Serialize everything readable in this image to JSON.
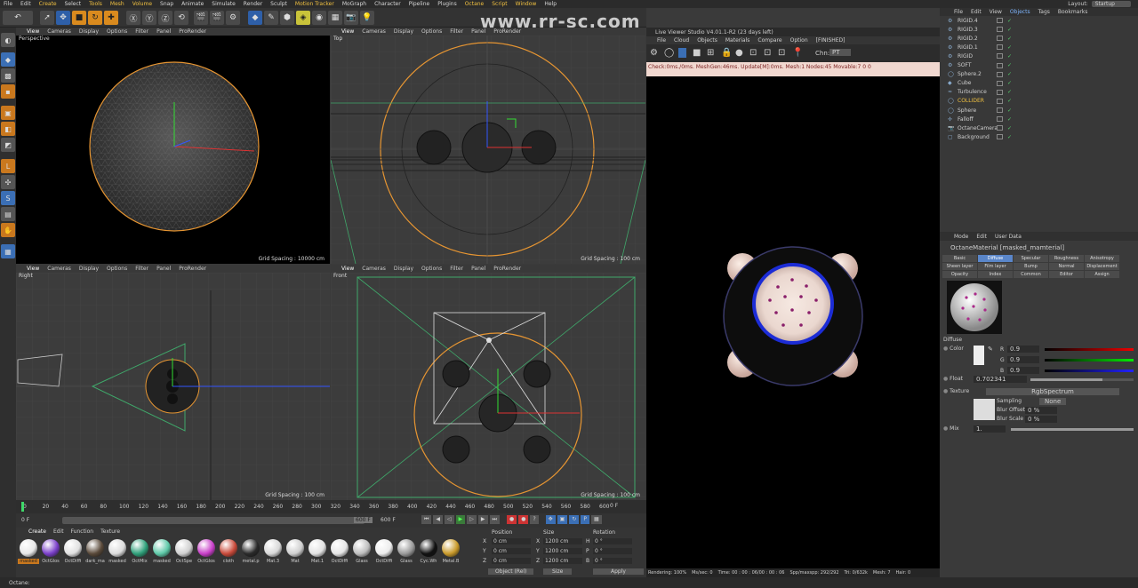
{
  "menubar": {
    "items": [
      "File",
      "Edit",
      "Create",
      "Select",
      "Tools",
      "Mesh",
      "Volume",
      "Snap",
      "Animate",
      "Simulate",
      "Render",
      "Sculpt",
      "Motion Tracker",
      "MoGraph",
      "Character",
      "Pipeline",
      "Plugins",
      "Octane",
      "Script",
      "Window",
      "Help"
    ],
    "layout_label": "Layout:",
    "layout_value": "Startup"
  },
  "watermark": "www.rr-sc.com",
  "viewport_menu": [
    "View",
    "Cameras",
    "Display",
    "Options",
    "Filter",
    "Panel",
    "ProRender"
  ],
  "viewports": [
    {
      "label": "Perspective",
      "grid": "Grid Spacing : 10000 cm"
    },
    {
      "label": "Top",
      "grid": "Grid Spacing : 100 cm"
    },
    {
      "label": "Right",
      "grid": "Grid Spacing : 100 cm"
    },
    {
      "label": "Front",
      "grid": "Grid Spacing : 100 cm"
    }
  ],
  "timeline": {
    "ticks": [
      "0",
      "20",
      "40",
      "60",
      "80",
      "100",
      "120",
      "140",
      "160",
      "180",
      "200",
      "220",
      "240",
      "260",
      "280",
      "300",
      "320",
      "340",
      "360",
      "380",
      "400",
      "420",
      "440",
      "460",
      "480",
      "500",
      "520",
      "540",
      "560",
      "580",
      "600"
    ],
    "current_frame": "0 F",
    "start": "0 F",
    "end": "600 F",
    "end2": "600 F",
    "right_frame": "0 F"
  },
  "material_tabs": [
    "Create",
    "Edit",
    "Function",
    "Texture"
  ],
  "materials": [
    {
      "name": "masked",
      "color": "#e8e8e8"
    },
    {
      "name": "OctGlos",
      "color": "#7a3fc9"
    },
    {
      "name": "OctDiffi",
      "color": "#e0e0e0"
    },
    {
      "name": "dark_ma",
      "color": "#5a4a3a"
    },
    {
      "name": "masked",
      "color": "#dcdcdc"
    },
    {
      "name": "OctMix",
      "color": "#2fa07a"
    },
    {
      "name": "masked",
      "color": "#5ec9a8"
    },
    {
      "name": "OctSpe",
      "color": "#d0d0d0"
    },
    {
      "name": "OctGlos",
      "color": "#c93fc9"
    },
    {
      "name": "cloth",
      "color": "#c94a3a"
    },
    {
      "name": "metal.p",
      "color": "#2a2a2a"
    },
    {
      "name": "Mat.3",
      "color": "#d8d8d8"
    },
    {
      "name": "Mat",
      "color": "#cfcfcf"
    },
    {
      "name": "Mat.1",
      "color": "#e2e2e2"
    },
    {
      "name": "OctDiffi",
      "color": "#e6e6e6"
    },
    {
      "name": "Glass",
      "color": "#bdbdbd"
    },
    {
      "name": "OctDiffi",
      "color": "#ececec"
    },
    {
      "name": "Glass",
      "color": "#9a9a9a"
    },
    {
      "name": "Cyc.Wh",
      "color": "#111111"
    },
    {
      "name": "Metal.B",
      "color": "#c99a2a"
    }
  ],
  "coords": {
    "headers": [
      "Position",
      "Size",
      "Rotation"
    ],
    "rows": [
      {
        "axis": "X",
        "pos": "0 cm",
        "size": "1200 cm",
        "rot_label": "H",
        "rot": "0 °"
      },
      {
        "axis": "Y",
        "pos": "0 cm",
        "size": "1200 cm",
        "rot_label": "P",
        "rot": "0 °"
      },
      {
        "axis": "Z",
        "pos": "0 cm",
        "size": "1200 cm",
        "rot_label": "B",
        "rot": "0 °"
      }
    ],
    "mode": "Object (Rel)",
    "size_mode": "Size",
    "apply": "Apply"
  },
  "status": "Octane:",
  "live": {
    "title": "Live Viewer Studio V4.01.1-R2 (23 days left)",
    "menu": [
      "File",
      "Cloud",
      "Objects",
      "Materials",
      "Compare",
      "Option",
      "[FINISHED]"
    ],
    "chn_label": "Chn:",
    "chn_value": "PT",
    "check": "Check:0ms./0ms. MeshGen:46ms. Update[M]:0ms. Mesh:1 Nodes:45 Movable:7  0 0",
    "bottom": [
      "Rendering: 100%",
      "Ms/sec: 0",
      "Time: 00 : 00 : 06/00 : 00 : 06",
      "Spp/maxspp: 292/292",
      "Tri: 0/632k",
      "Mesh: 7",
      "Hair: 0"
    ]
  },
  "objects": {
    "menu": [
      "File",
      "Edit",
      "View",
      "Objects",
      "Tags",
      "Bookmarks"
    ],
    "items": [
      "RIGID.4",
      "RIGID.3",
      "RIGID.2",
      "RIGID.1",
      "RIGID",
      "SOFT",
      "Sphere.2",
      "Cube",
      "Turbulence",
      "COLLIDER",
      "Sphere",
      "Falloff",
      "OctaneCamera",
      "Background"
    ]
  },
  "attributes": {
    "menu": [
      "Mode",
      "Edit",
      "User Data"
    ],
    "title": "OctaneMaterial [masked_mamterial]",
    "tabs": [
      "Basic",
      "Diffuse",
      "Specular",
      "Roughness",
      "Anisotropy",
      "Sheen layer",
      "Film layer",
      "Bump",
      "Normal",
      "Displacement",
      "Opacity",
      "Index",
      "Common",
      "Editor",
      "Assign"
    ],
    "active_tab": "Diffuse",
    "section": "Diffuse",
    "color_label": "Color",
    "r_label": "R",
    "r": "0.9",
    "g_label": "G",
    "g": "0.9",
    "b_label": "B",
    "b": "0.9",
    "float_label": "Float",
    "float": "0.702341",
    "texture_label": "Texture",
    "texture_value": "RgbSpectrum",
    "sampling_label": "Sampling",
    "sampling_value": "None",
    "blur_offset_label": "Blur Offset",
    "blur_offset": "0 %",
    "blur_scale_label": "Blur Scale",
    "blur_scale": "0 %",
    "mix_label": "Mix",
    "mix": "1."
  }
}
